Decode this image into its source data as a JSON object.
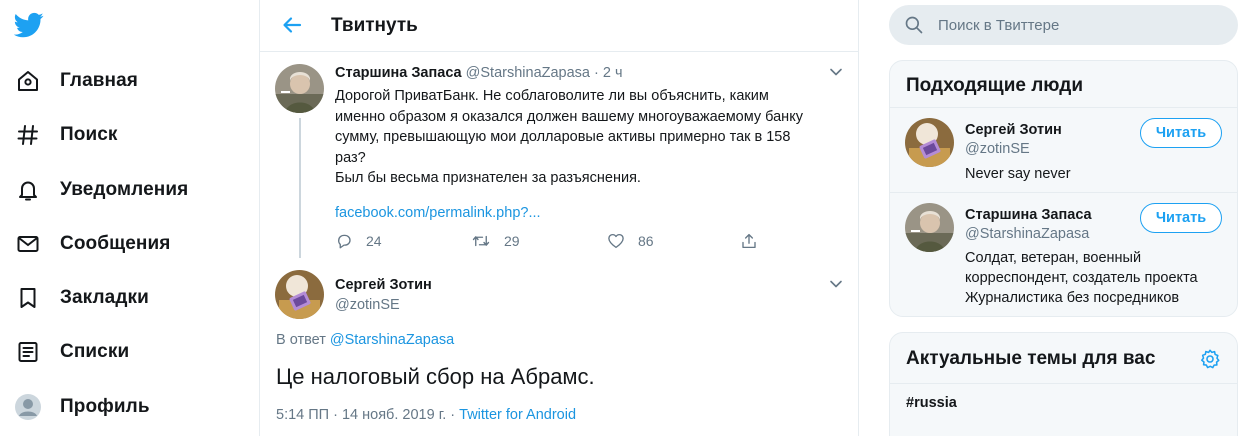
{
  "nav": {
    "items": [
      {
        "label": "Главная",
        "icon": "home-icon"
      },
      {
        "label": "Поиск",
        "icon": "hashtag-icon"
      },
      {
        "label": "Уведомления",
        "icon": "bell-icon"
      },
      {
        "label": "Сообщения",
        "icon": "mail-icon"
      },
      {
        "label": "Закладки",
        "icon": "bookmark-icon"
      },
      {
        "label": "Списки",
        "icon": "list-icon"
      },
      {
        "label": "Профиль",
        "icon": "avatar-icon"
      }
    ]
  },
  "header": {
    "title": "Твитнуть"
  },
  "tweet1": {
    "name": "Старшина Запаса",
    "handle": "@StarshinaZapasa",
    "sep": "·",
    "time": "2 ч",
    "lines": [
      "Дорогой ПриватБанк. Не соблаговолите ли вы объяснить, каким",
      "именно образом я оказался должен вашему многоуважаемому банку",
      "сумму, превышающую мои долларовые активы примерно так в 158",
      "раз?",
      "Был бы весьма признателен за разъяснения."
    ],
    "link": "facebook.com/permalink.php?...",
    "replies": "24",
    "retweets": "29",
    "likes": "86"
  },
  "tweet2": {
    "name": "Сергей Зотин",
    "handle": "@zotinSE",
    "reply_prefix": "В ответ",
    "reply_to": "@StarshinaZapasa",
    "text": "Це налоговый сбор на Абрамс.",
    "timestamp": "5:14 ПП · 14 нояб. 2019 г. ·",
    "source": "Twitter for Android"
  },
  "search": {
    "placeholder": "Поиск в Твиттере"
  },
  "who_to_follow": {
    "title": "Подходящие люди",
    "people": [
      {
        "name": "Сергей Зотин",
        "handle": "@zotinSE",
        "bio": [
          "Never say never"
        ],
        "button": "Читать"
      },
      {
        "name": "Старшина Запаса",
        "handle": "@StarshinaZapasa",
        "bio": [
          "Солдат, ветеран, военный",
          "корреспондент, создатель проекта",
          "Журналистика без посредников"
        ],
        "button": "Читать"
      }
    ]
  },
  "trends": {
    "title": "Актуальные темы для вас",
    "items": [
      "#russia"
    ]
  },
  "colors": {
    "accent": "#1da1f2",
    "muted": "#657786",
    "border": "#e6ecf0",
    "panel": "#f5f8fa"
  }
}
